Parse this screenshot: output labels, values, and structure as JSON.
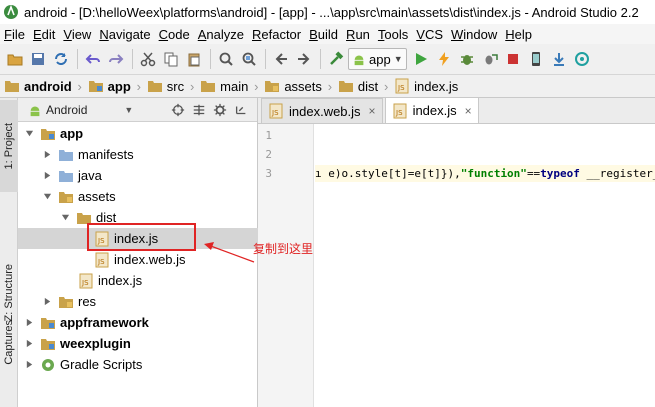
{
  "window": {
    "title": "android - [D:\\helloWeex\\platforms\\android] - [app] - ...\\app\\src\\main\\assets\\dist\\index.js - Android Studio 2.2"
  },
  "menu": [
    "File",
    "Edit",
    "View",
    "Navigate",
    "Code",
    "Analyze",
    "Refactor",
    "Build",
    "Run",
    "Tools",
    "VCS",
    "Window",
    "Help"
  ],
  "toolbar": {
    "run_config": "app"
  },
  "breadcrumb": [
    "android",
    "app",
    "src",
    "main",
    "assets",
    "dist",
    "index.js"
  ],
  "side_tabs": {
    "project": "1: Project",
    "structure": "Z: Structure",
    "captures": "Captures"
  },
  "project_panel": {
    "view_mode": "Android",
    "tree": [
      {
        "label": "app",
        "bold": true
      },
      {
        "label": "manifests"
      },
      {
        "label": "java"
      },
      {
        "label": "assets"
      },
      {
        "label": "dist"
      },
      {
        "label": "index.js"
      },
      {
        "label": "index.web.js"
      },
      {
        "label": "index.js"
      },
      {
        "label": "res"
      },
      {
        "label": "appframework",
        "bold": true
      },
      {
        "label": "weexplugin",
        "bold": true
      },
      {
        "label": "Gradle Scripts"
      }
    ]
  },
  "annotation": {
    "text": "复制到这里",
    "color": "#e02424"
  },
  "editor": {
    "tabs": [
      {
        "label": "index.web.js",
        "active": false
      },
      {
        "label": "index.js",
        "active": true
      }
    ],
    "line_numbers": [
      "1",
      "2",
      "3"
    ],
    "code_line3": {
      "part1": "ı e)o.style[t]=e[t]}),",
      "string": "\"function\"",
      "part2": "==",
      "keyword": "typeof",
      "part3": " __register_st"
    }
  },
  "colors": {
    "accent_red": "#e02424",
    "folder": "#c9a24a",
    "android_green": "#8bc34a"
  }
}
